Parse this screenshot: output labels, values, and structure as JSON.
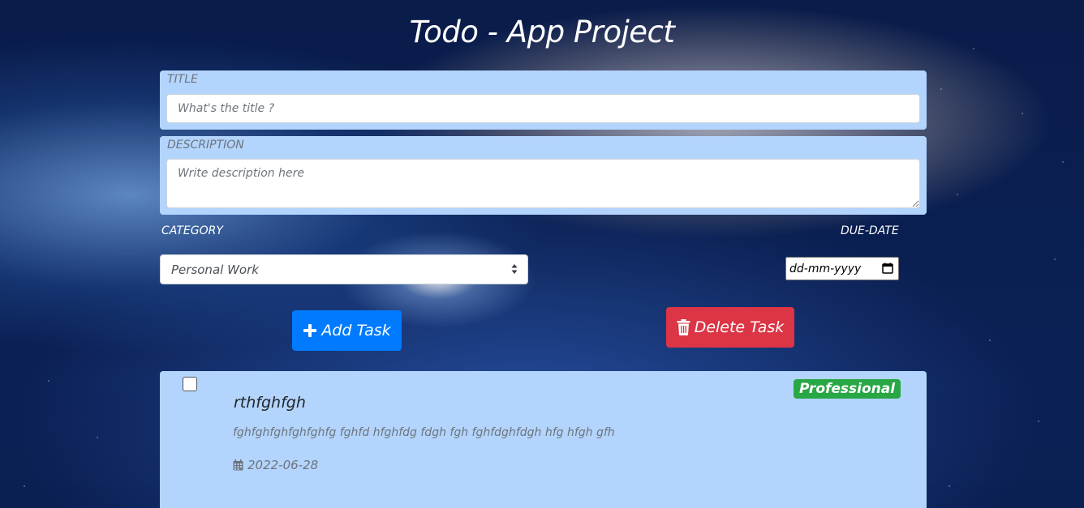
{
  "app": {
    "title": "Todo - App Project"
  },
  "form": {
    "title_label": "TITLE",
    "title_placeholder": "What's the title ?",
    "description_label": "DESCRIPTION",
    "description_placeholder": "Write description here",
    "category_label": "CATEGORY",
    "category_value": "Personal Work",
    "due_label": "DUE-DATE",
    "due_placeholder": "dd-mm-yyyy"
  },
  "buttons": {
    "add_label": "Add Task",
    "delete_label": "Delete Task"
  },
  "tasks": [
    {
      "title": "rthfghfgh",
      "description": "fghfghfghfghfghfg fghfd hfghfdg fdgh fgh fghfdghfdgh hfg hfgh gfh",
      "date": "2022-06-28",
      "category": "Professional",
      "checked": false
    }
  ],
  "colors": {
    "panel": "#b3d4fc",
    "add_button": "#007bff",
    "delete_button": "#dc3545",
    "badge": "#28a745"
  },
  "icons": {
    "add": "plus-icon",
    "delete": "trash-icon",
    "date": "calendar-icon",
    "select": "sort-arrows-icon"
  }
}
